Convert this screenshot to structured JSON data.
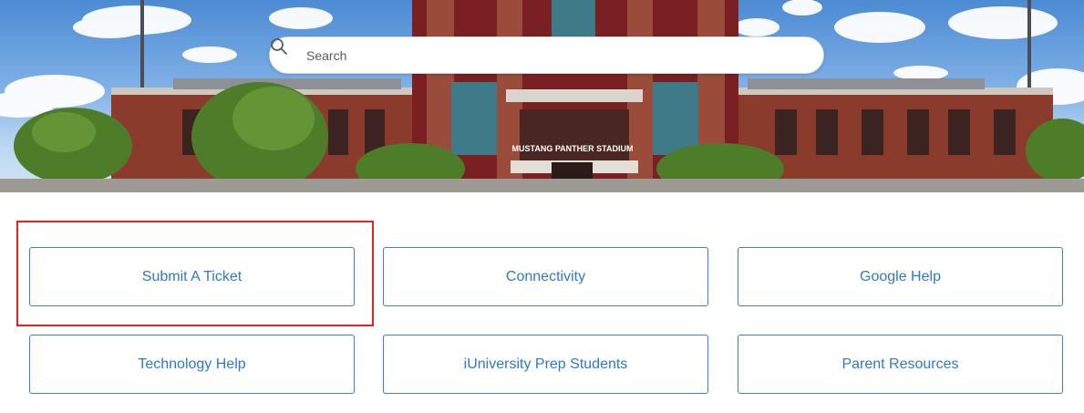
{
  "hero": {
    "banner_sign": "MUSTANG PANTHER STADIUM"
  },
  "search": {
    "placeholder": "Search",
    "value": "",
    "icon": "search-icon"
  },
  "tiles": [
    {
      "label": "Submit A Ticket",
      "highlighted": true
    },
    {
      "label": "Connectivity"
    },
    {
      "label": "Google Help"
    },
    {
      "label": "Technology Help"
    },
    {
      "label": "iUniversity Prep Students"
    },
    {
      "label": "Parent Resources"
    }
  ],
  "colors": {
    "tile_border": "#3c7fd0",
    "tile_text": "#2f78cc",
    "highlight": "#e0252a"
  }
}
